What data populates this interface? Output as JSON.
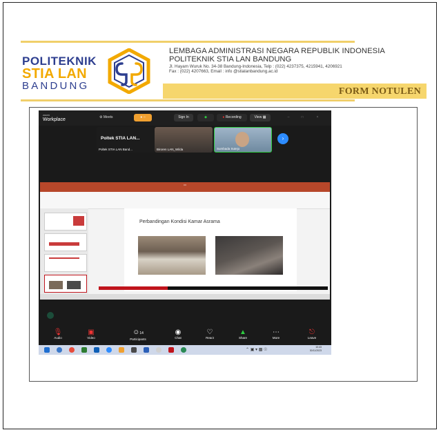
{
  "header": {
    "logo_line1": "POLITEKNIK",
    "logo_line2": "STIA LAN",
    "logo_line3": "BANDUNG",
    "institution_line1": "LEMBAGA ADMINISTRASI NEGARA REPUBLIK INDONESIA",
    "institution_line2": "POLITEKNIK STIA LAN BANDUNG",
    "address": "Jl. Hayam Wuruk No. 34-38 Bandung-Indonesia, Telp : (022) 4237375, 4215941, 4206921",
    "contact": "Fax : (022) 4207663, Email : info @stialanbandung.ac.id",
    "form_title": "FORM NOTULEN",
    "colors": {
      "navy": "#2d3e8f",
      "gold": "#f2a900",
      "band": "#f6d66d"
    }
  },
  "screenshot": {
    "zoom": {
      "app_name": "Workplace",
      "app_sub": "zoom",
      "meets_label": "Meets",
      "sign_in_label": "Sign In",
      "recording_label": "Recording",
      "view_label": "View"
    },
    "participants": [
      {
        "name": "Poltek STIA LAN...",
        "label": "Poltek STIA LAN Band..."
      },
      {
        "name": "",
        "label": "Biroren LAN_Wilda"
      },
      {
        "name": "",
        "label": "Sumbada Sutejo"
      }
    ],
    "slide": {
      "title": "Perbandingan Kondisi Kamar Asrama"
    },
    "toolbar": [
      {
        "icon": "mic-muted-icon",
        "label": "Audio"
      },
      {
        "icon": "video-icon",
        "label": "Video"
      },
      {
        "icon": "participants-icon",
        "label": "Participants",
        "count": "14"
      },
      {
        "icon": "chat-icon",
        "label": "Chat"
      },
      {
        "icon": "react-icon",
        "label": "React"
      },
      {
        "icon": "share-icon",
        "label": "Share"
      },
      {
        "icon": "more-icon",
        "label": "More"
      },
      {
        "icon": "leave-icon",
        "label": "Leave"
      }
    ],
    "clock": {
      "time": "10:43",
      "date": "30/11/2023"
    }
  }
}
